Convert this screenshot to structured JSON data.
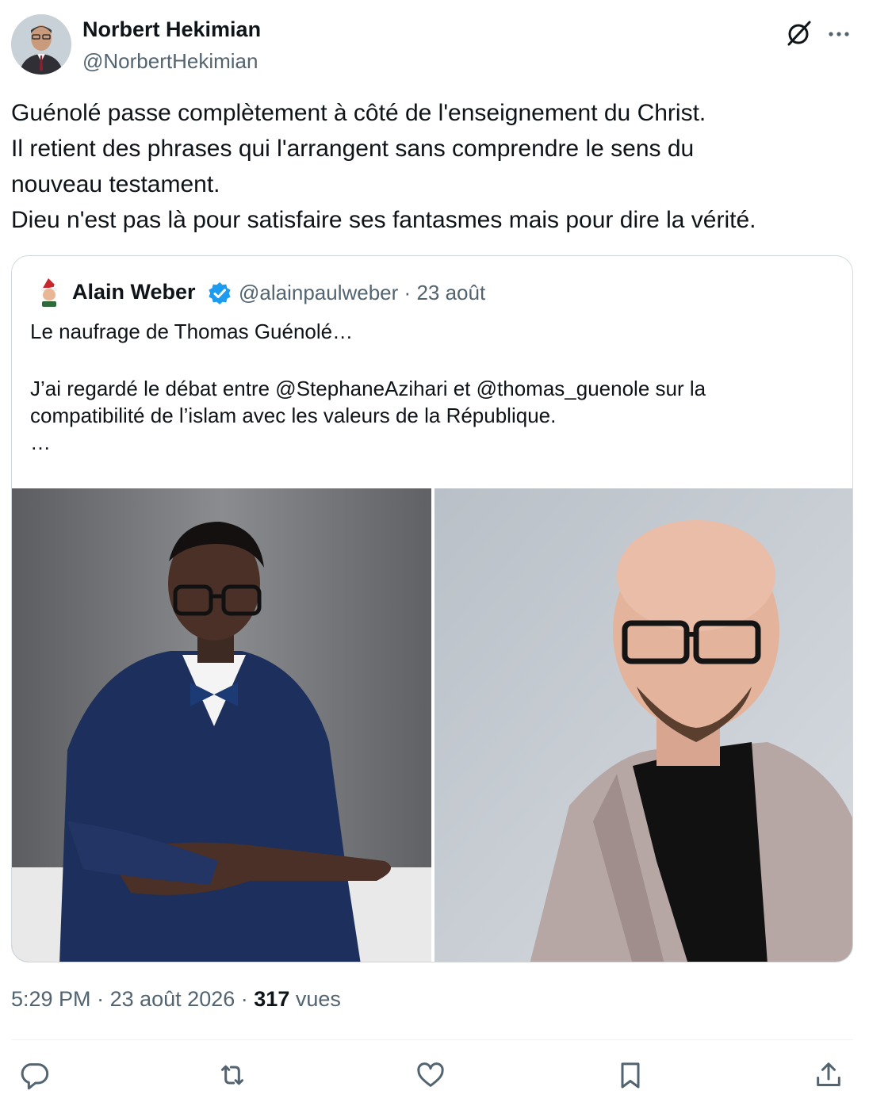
{
  "tweet": {
    "author_name": "Norbert Hekimian",
    "author_handle": "@NorbertHekimian",
    "text_lines": [
      "Guénolé passe complètement à côté de l'enseignement du Christ.",
      "Il retient des phrases qui l'arrangent sans comprendre le sens du",
      "nouveau testament.",
      "Dieu n'est pas là pour satisfaire ses fantasmes mais pour dire la vérité."
    ],
    "time": "5:29 PM",
    "date": "23 août 2026",
    "separator": "·",
    "views_count": "317",
    "views_label": "vues"
  },
  "quote": {
    "author_name": "Alain Weber",
    "author_handle": "@alainpaulweber",
    "separator": "·",
    "date": "23 août",
    "verified": true,
    "text_lines": [
      "Le naufrage de Thomas Guénolé…",
      "",
      "J’ai regardé le débat entre @StephaneAzihari et @thomas_guenole sur la",
      "compatibilité de l’islam avec les valeurs de la République.",
      "…"
    ]
  },
  "icons": {
    "grok": "grok-icon",
    "more": "more-horizontal-icon",
    "verified": "verified-badge-icon",
    "reply": "reply-icon",
    "repost": "repost-icon",
    "like": "like-icon",
    "bookmark": "bookmark-icon",
    "share": "share-icon"
  },
  "colors": {
    "text": "#0f1419",
    "secondary": "#536471",
    "verified": "#1d9bf0",
    "border": "#cfd9de"
  }
}
